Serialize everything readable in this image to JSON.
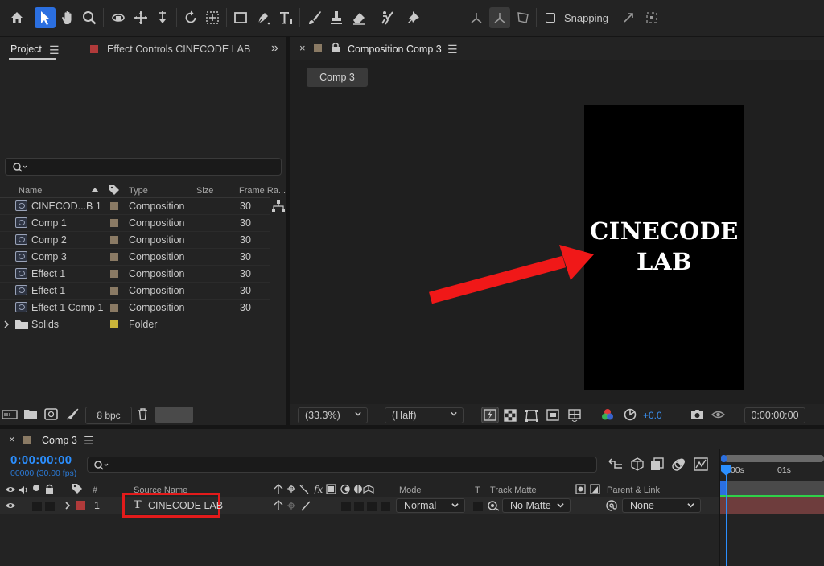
{
  "toolbar": {
    "tools": [
      "home",
      "selection",
      "hand",
      "zoom",
      "orbit",
      "pan",
      "dolly",
      "rotate",
      "anchor",
      "rectangle",
      "pen",
      "type",
      "brush",
      "clone-stamp",
      "eraser",
      "roto-brush",
      "puppet-pin"
    ],
    "snapping_label": "Snapping"
  },
  "project_panel": {
    "tab_label": "Project",
    "effect_controls_tab": "Effect Controls CINECODE LAB",
    "search_placeholder": "",
    "columns": {
      "name": "Name",
      "type": "Type",
      "size": "Size",
      "frame_rate": "Frame Ra..."
    },
    "items": [
      {
        "name": "CINECOD...B 1",
        "type": "Composition",
        "frame_rate": "30"
      },
      {
        "name": "Comp 1",
        "type": "Composition",
        "frame_rate": "30"
      },
      {
        "name": "Comp 2",
        "type": "Composition",
        "frame_rate": "30"
      },
      {
        "name": "Comp 3",
        "type": "Composition",
        "frame_rate": "30"
      },
      {
        "name": "Effect 1",
        "type": "Composition",
        "frame_rate": "30"
      },
      {
        "name": "Effect 1",
        "type": "Composition",
        "frame_rate": "30"
      },
      {
        "name": "Effect 1 Comp 1",
        "type": "Composition",
        "frame_rate": "30"
      }
    ],
    "folder": {
      "name": "Solids",
      "type": "Folder"
    },
    "bpc_label": "8 bpc"
  },
  "composition_panel": {
    "tab_label": "Composition Comp 3",
    "subtab": "Comp 3",
    "canvas_text_line1": "CINECODE",
    "canvas_text_line2": "LAB",
    "zoom": "(33.3%)",
    "resolution": "(Half)",
    "exposure": "+0.0",
    "timecode": "0:00:00:00"
  },
  "timeline": {
    "tab_label": "Comp 3",
    "current_time": "0:00:00:00",
    "frame_info": "00000 (30.00 fps)",
    "columns": {
      "number": "#",
      "source_name": "Source Name",
      "mode": "Mode",
      "t": "T",
      "track_matte": "Track Matte",
      "parent_link": "Parent & Link"
    },
    "layer": {
      "number": "1",
      "name": "CINECODE LAB",
      "mode": "Normal",
      "track_matte": "No Matte",
      "parent": "None"
    },
    "ruler": {
      "tick_0": ":00s",
      "tick_1": "01s"
    }
  },
  "colors": {
    "accent": "#2b6fe0",
    "timecode": "#2b8fff",
    "highlight_box": "#e21b1b",
    "arrow": "#f01818",
    "layer_label": "#b03a3a",
    "track_bar": "#6e3d3d"
  }
}
